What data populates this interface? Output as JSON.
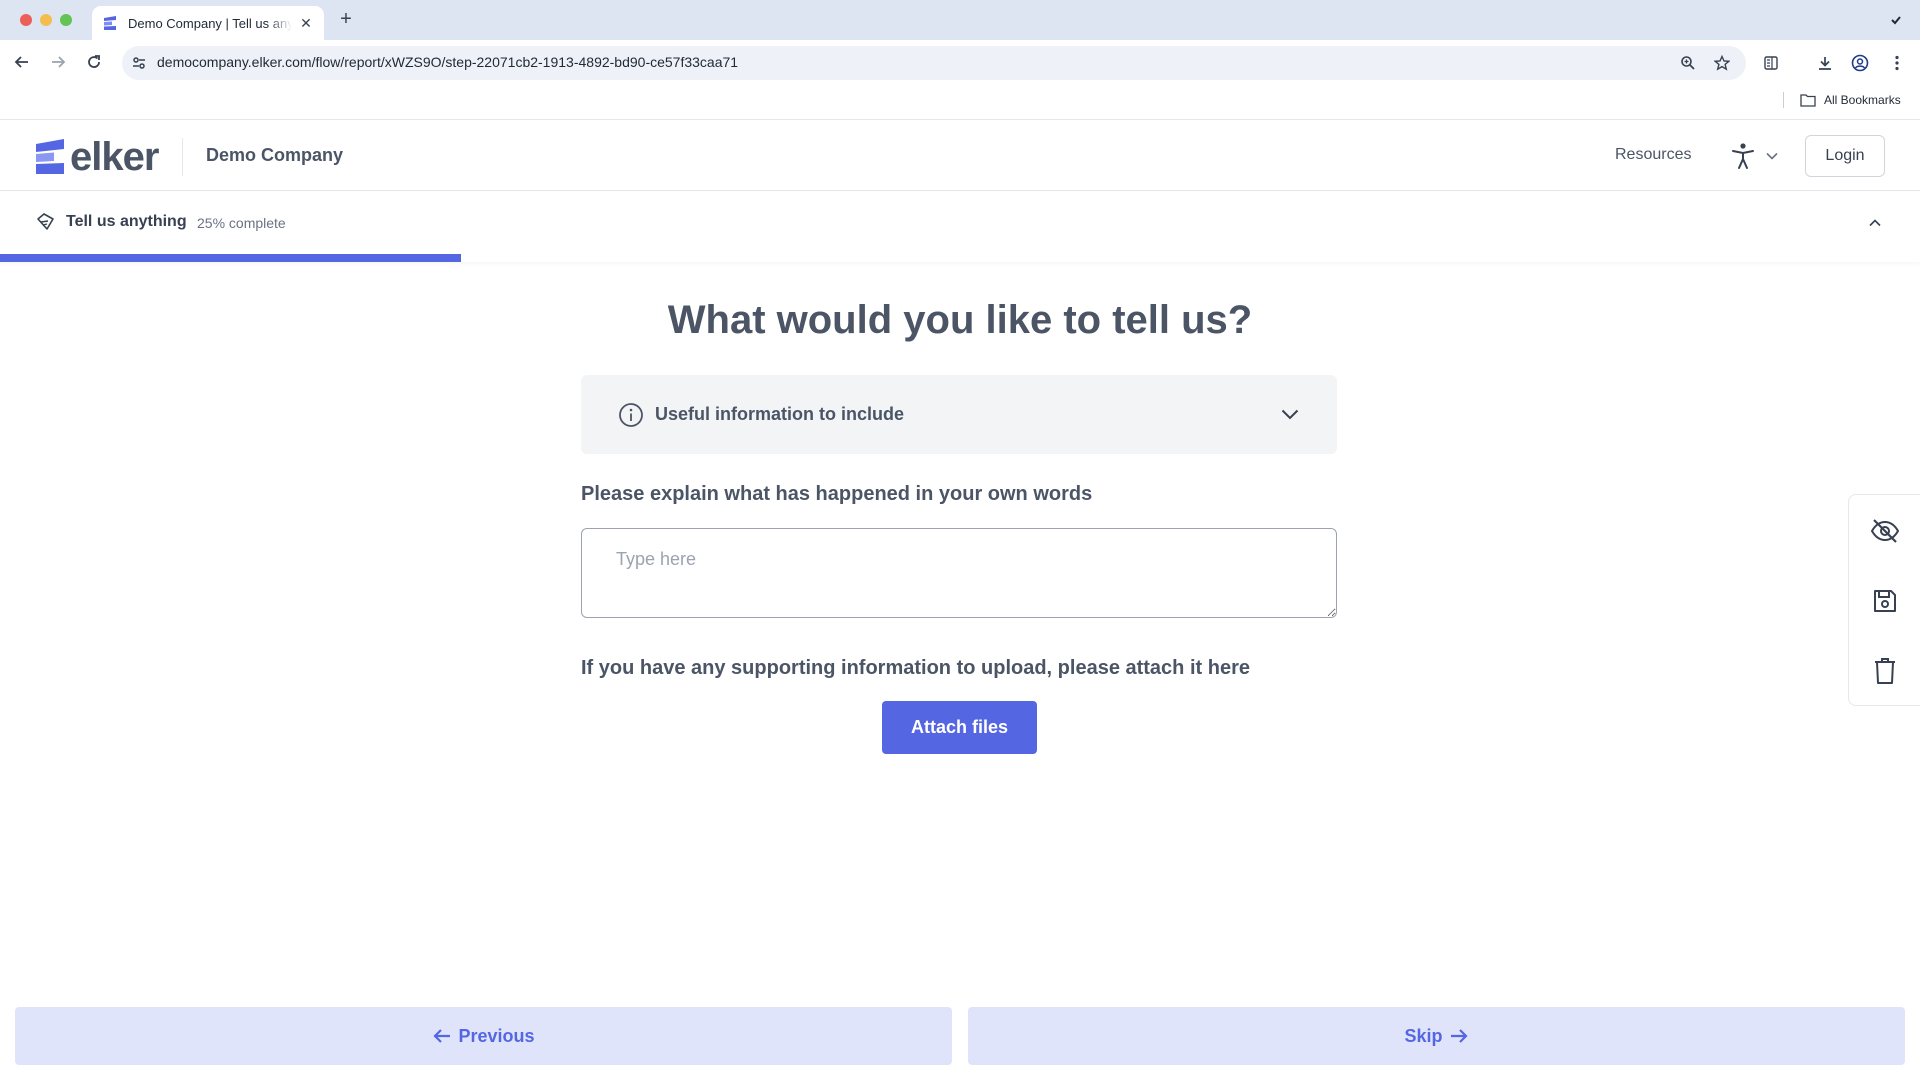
{
  "browser": {
    "tab_title": "Demo Company | Tell us anything",
    "new_tab_label": "+",
    "url": "democompany.elker.com/flow/report/xWZS9O/step-22071cb2-1913-4892-bd90-ce57f33caa71",
    "all_bookmarks_label": "All Bookmarks"
  },
  "header": {
    "logo_text": "elker",
    "company_name": "Demo Company",
    "resources_label": "Resources",
    "login_label": "Login"
  },
  "progress": {
    "step_title": "Tell us anything",
    "percent_label": "25% complete",
    "percent_value": 25
  },
  "main": {
    "question": "What would you like to tell us?",
    "info_panel_label": "Useful information to include",
    "field_label": "Please explain what has happened in your own words",
    "textarea_placeholder": "Type here",
    "upload_label": "If you have any supporting information to upload, please attach it here",
    "attach_button_label": "Attach files"
  },
  "footer": {
    "previous_label": "Previous",
    "skip_label": "Skip"
  },
  "colors": {
    "accent": "#5566e3",
    "footer_button_bg": "#e0e4fb",
    "text_heading": "#4b5566"
  }
}
